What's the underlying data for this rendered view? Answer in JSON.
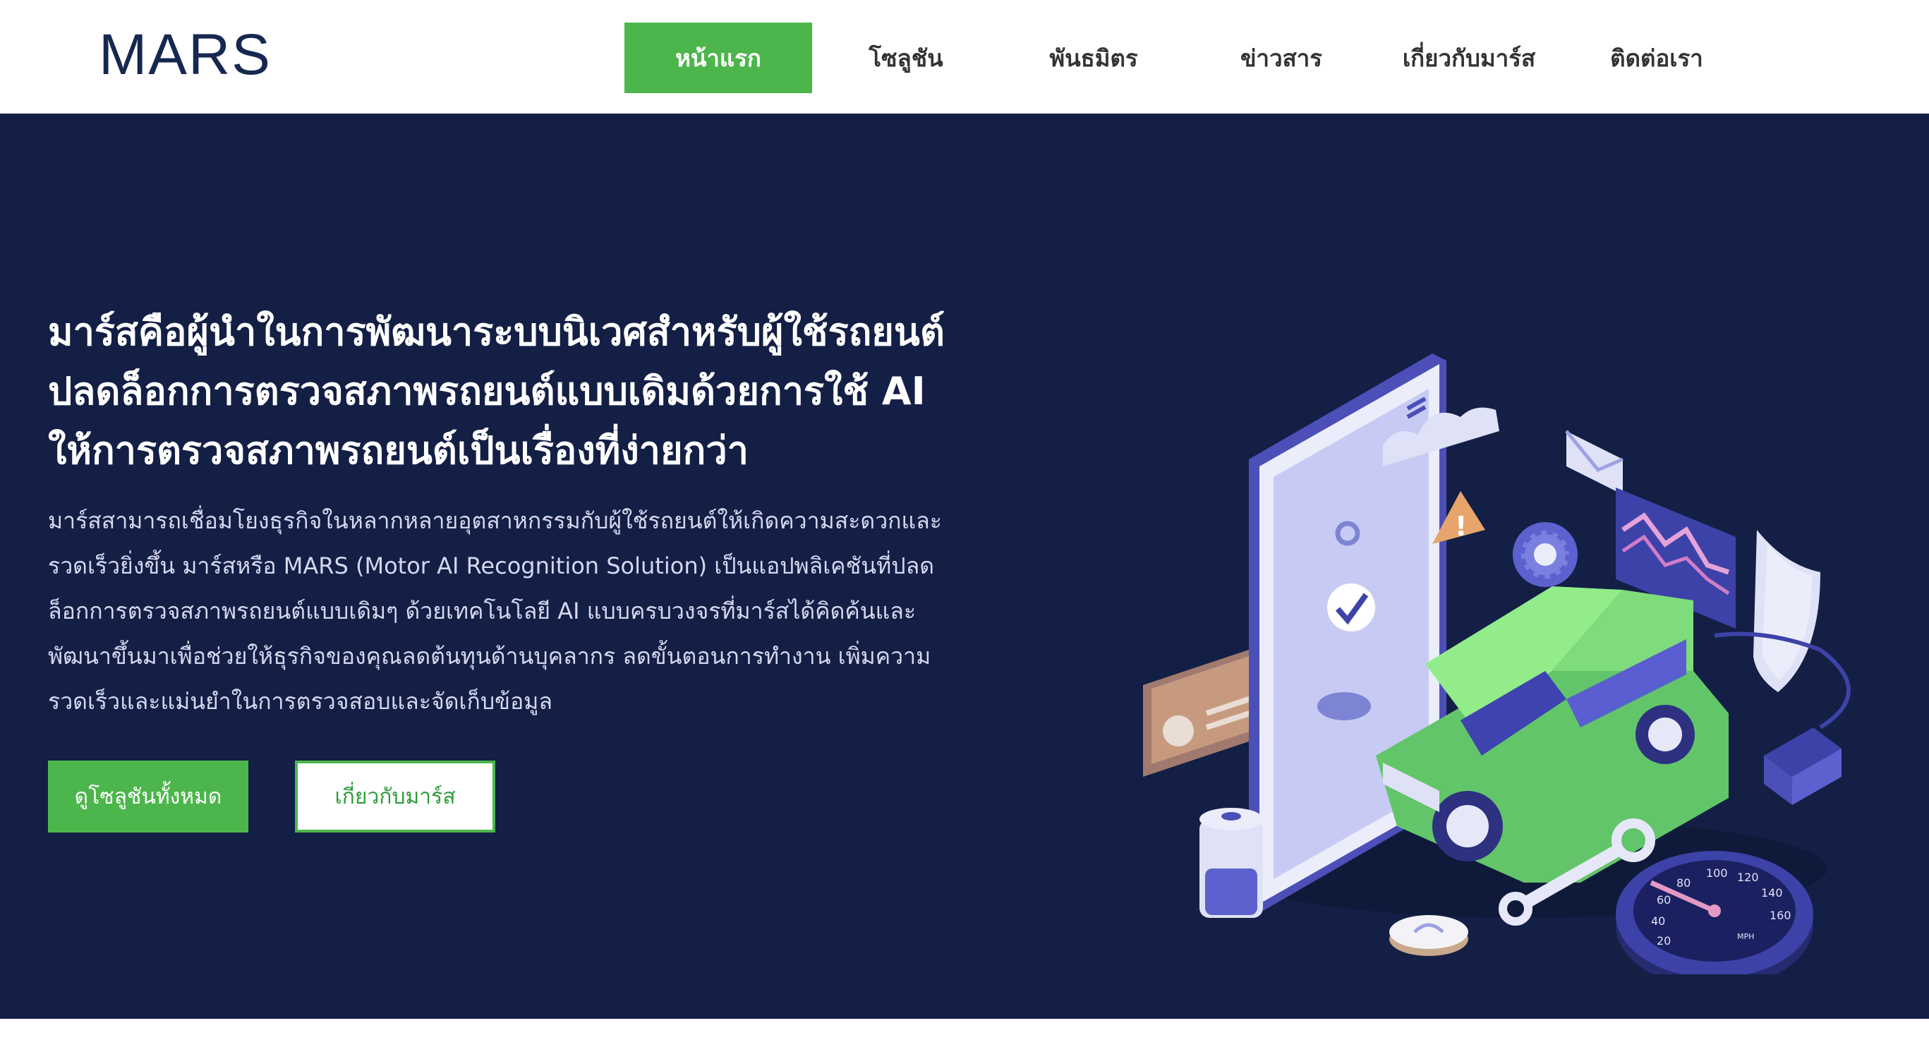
{
  "brand": {
    "logo_text": "MARS",
    "accent_color": "#4cb64c",
    "navy_color": "#131f45"
  },
  "nav": {
    "items": [
      {
        "label": "หน้าแรก",
        "active": true
      },
      {
        "label": "โซลูชัน",
        "active": false
      },
      {
        "label": "พันธมิตร",
        "active": false
      },
      {
        "label": "ข่าวสาร",
        "active": false
      },
      {
        "label": "เกี่ยวกับมาร์ส",
        "active": false
      },
      {
        "label": "ติดต่อเรา",
        "active": false
      }
    ]
  },
  "hero": {
    "heading": [
      "มาร์สคือผู้นำในการพัฒนาระบบนิเวศสำหรับผู้ใช้รถยนต์",
      "ปลดล็อกการตรวจสภาพรถยนต์แบบเดิมด้วยการใช้ AI",
      "ให้การตรวจสภาพรถยนต์เป็นเรื่องที่ง่ายกว่า"
    ],
    "description": [
      "มาร์สสามารถเชื่อมโยงธุรกิจในหลากหลายอุตสาหกรรมกับผู้ใช้รถยนต์ให้เกิดความสะดวกและ",
      "รวดเร็วยิ่งขึ้น มาร์สหรือ MARS (Motor AI Recognition Solution) เป็นแอปพลิเคชันที่ปลด",
      "ล็อกการตรวจสภาพรถยนต์แบบเดิมๆ ด้วยเทคโนโลยี AI แบบครบวงจรที่มาร์สได้คิดค้นและ",
      "พัฒนาขึ้นมาเพื่อช่วยให้ธุรกิจของคุณลดต้นทุนด้านบุคลากร ลดขั้นตอนการทำงาน เพิ่มความ",
      "รวดเร็วและแม่นยำในการตรวจสอบและจัดเก็บข้อมูล"
    ],
    "primary_button": "ดูโซลูชันทั้งหมด",
    "secondary_button": "เกี่ยวกับมาร์ส"
  },
  "illustration": {
    "speedometer_ticks": [
      "20",
      "40",
      "60",
      "80",
      "100",
      "120",
      "140",
      "160"
    ],
    "speedometer_unit": "MPH"
  }
}
